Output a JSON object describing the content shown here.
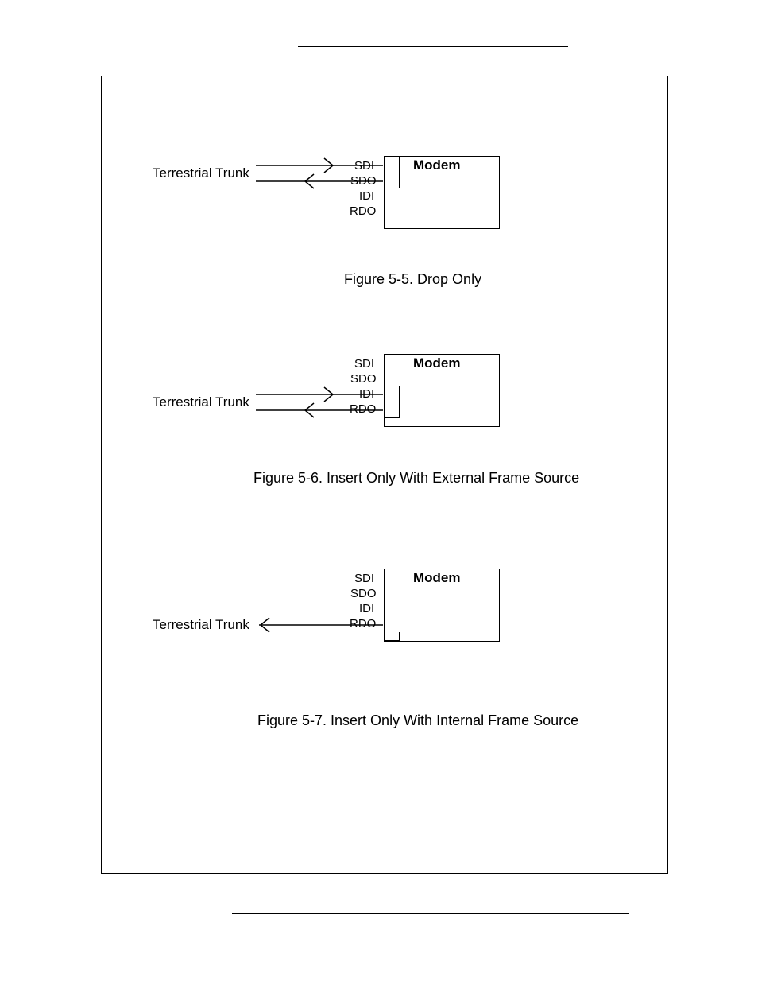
{
  "figures": [
    {
      "trunk_label": "Terrestrial Trunk",
      "modem_label": "Modem",
      "ports": {
        "p1": "SDI",
        "p2": "SDO",
        "p3": "IDI",
        "p4": "RDO"
      },
      "caption": "Figure 5-5.  Drop Only"
    },
    {
      "trunk_label": "Terrestrial Trunk",
      "modem_label": "Modem",
      "ports": {
        "p1": "SDI",
        "p2": "SDO",
        "p3": "IDI",
        "p4": "RDO"
      },
      "caption": "Figure 5-6.  Insert Only With External Frame Source"
    },
    {
      "trunk_label": "Terrestrial Trunk",
      "modem_label": "Modem",
      "ports": {
        "p1": "SDI",
        "p2": "SDO",
        "p3": "IDI",
        "p4": "RDO"
      },
      "caption": "Figure 5-7.  Insert Only With Internal Frame Source"
    }
  ]
}
